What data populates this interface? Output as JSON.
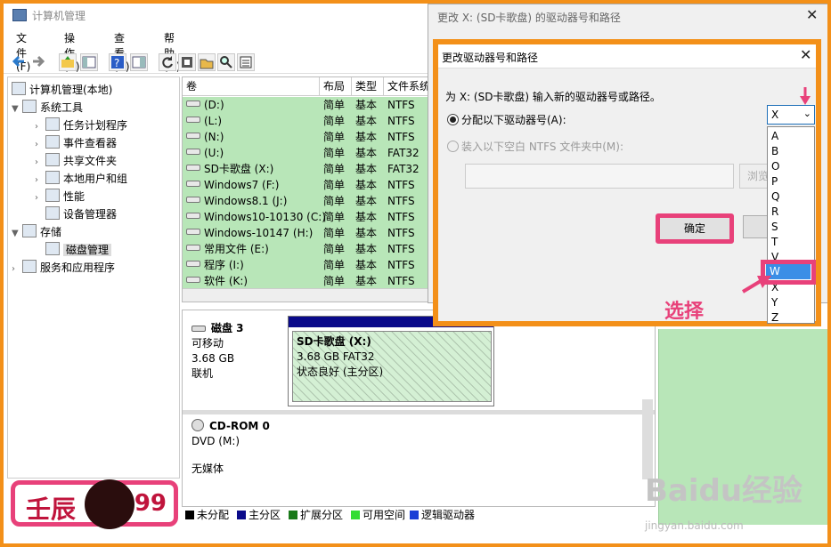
{
  "app": {
    "title": "计算机管理"
  },
  "menu": [
    "文件(F)",
    "操作(A)",
    "查看(V)",
    "帮助(H)"
  ],
  "tree": {
    "root": "计算机管理(本地)",
    "system_tools": "系统工具",
    "items": [
      "任务计划程序",
      "事件查看器",
      "共享文件夹",
      "本地用户和组",
      "性能",
      "设备管理器"
    ],
    "storage": "存储",
    "disk_mgmt": "磁盘管理",
    "services": "服务和应用程序"
  },
  "volumes": {
    "headers": [
      "卷",
      "布局",
      "类型",
      "文件系统"
    ],
    "rows": [
      [
        "(D:)",
        "简单",
        "基本",
        "NTFS"
      ],
      [
        "(L:)",
        "简单",
        "基本",
        "NTFS"
      ],
      [
        "(N:)",
        "简单",
        "基本",
        "NTFS"
      ],
      [
        "(U:)",
        "简单",
        "基本",
        "FAT32"
      ],
      [
        "SD卡歌盘 (X:)",
        "简单",
        "基本",
        "FAT32"
      ],
      [
        "Windows7 (F:)",
        "简单",
        "基本",
        "NTFS"
      ],
      [
        "Windows8.1 (J:)",
        "简单",
        "基本",
        "NTFS"
      ],
      [
        "Windows10-10130 (C:)",
        "简单",
        "基本",
        "NTFS"
      ],
      [
        "Windows-10147 (H:)",
        "简单",
        "基本",
        "NTFS"
      ],
      [
        "常用文件 (E:)",
        "简单",
        "基本",
        "NTFS"
      ],
      [
        "程序 (I:)",
        "简单",
        "基本",
        "NTFS"
      ],
      [
        "软件 (K:)",
        "简单",
        "基本",
        "NTFS"
      ]
    ]
  },
  "disk3": {
    "name": "磁盘 3",
    "type": "可移动",
    "size": "3.68 GB",
    "status": "联机",
    "partition": {
      "name": "SD卡歌盘  (X:)",
      "size": "3.68 GB FAT32",
      "state": "状态良好 (主分区)"
    }
  },
  "cdrom": {
    "name": "CD-ROM 0",
    "drive": "DVD (M:)",
    "media": "无媒体"
  },
  "legend": [
    {
      "label": "未分配",
      "color": "#000000"
    },
    {
      "label": "主分区",
      "color": "#0a0a8a"
    },
    {
      "label": "扩展分区",
      "color": "#1a7a1a"
    },
    {
      "label": "可用空间",
      "color": "#33dd33"
    },
    {
      "label": "逻辑驱动器",
      "color": "#1a3fd6"
    }
  ],
  "back_dialog": {
    "title": "更改 X: (SD卡歌盘) 的驱动器号和路径",
    "ok": "确定"
  },
  "front_dialog": {
    "title": "更改驱动器号和路径",
    "prompt": "为 X: (SD卡歌盘) 输入新的驱动器号或路径。",
    "assign_label": "分配以下驱动器号(A):",
    "mount_label": "装入以下空白 NTFS 文件夹中(M):",
    "browse": "浏览",
    "ok": "确定"
  },
  "dropdown": {
    "selected": "X",
    "options": [
      "A",
      "B",
      "O",
      "P",
      "Q",
      "R",
      "S",
      "T",
      "V",
      "W",
      "X",
      "Y",
      "Z"
    ],
    "highlighted": "W"
  },
  "annotation": "选择",
  "watermark": {
    "badge": "壬辰",
    "badge_num": "99",
    "baidu": "Baidu经验",
    "url": "jingyan.baidu.com"
  }
}
